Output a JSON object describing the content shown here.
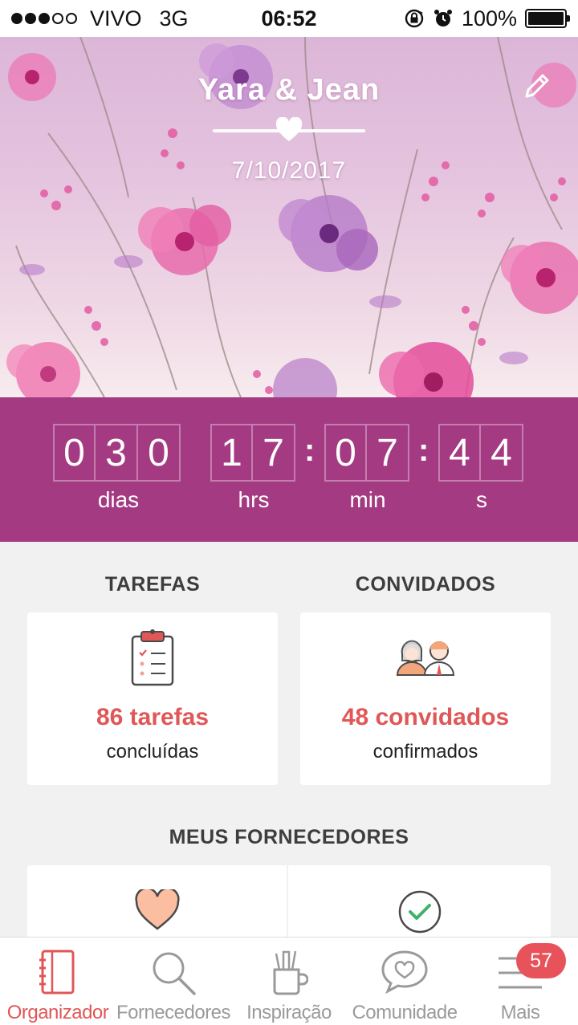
{
  "status_bar": {
    "carrier": "VIVO",
    "network": "3G",
    "time": "06:52",
    "battery": "100%"
  },
  "header": {
    "couple": "Yara & Jean",
    "date": "7/10/2017"
  },
  "countdown": {
    "days": [
      "0",
      "3",
      "0"
    ],
    "hours": [
      "1",
      "7"
    ],
    "minutes": [
      "0",
      "7"
    ],
    "seconds": [
      "4",
      "4"
    ],
    "separator": ":",
    "labels": {
      "days": "dias",
      "hours": "hrs",
      "minutes": "min",
      "seconds": "s"
    }
  },
  "tasks": {
    "title": "TAREFAS",
    "count": "86 tarefas",
    "subtitle": "concluídas"
  },
  "guests": {
    "title": "CONVIDADOS",
    "count": "48 convidados",
    "subtitle": "confirmados"
  },
  "vendors": {
    "title": "MEUS FORNECEDORES"
  },
  "tabbar": {
    "items": [
      {
        "label": "Organizador",
        "icon": "notebook-icon",
        "active": true
      },
      {
        "label": "Fornecedores",
        "icon": "search-icon",
        "active": false
      },
      {
        "label": "Inspiração",
        "icon": "pencil-cup-icon",
        "active": false
      },
      {
        "label": "Comunidade",
        "icon": "chat-heart-icon",
        "active": false
      },
      {
        "label": "Mais",
        "icon": "menu-icon",
        "active": false
      }
    ],
    "badge": "57"
  },
  "colors": {
    "accent": "#e05757",
    "countdown_bg": "#a43a82",
    "background": "#f1f1f1"
  }
}
